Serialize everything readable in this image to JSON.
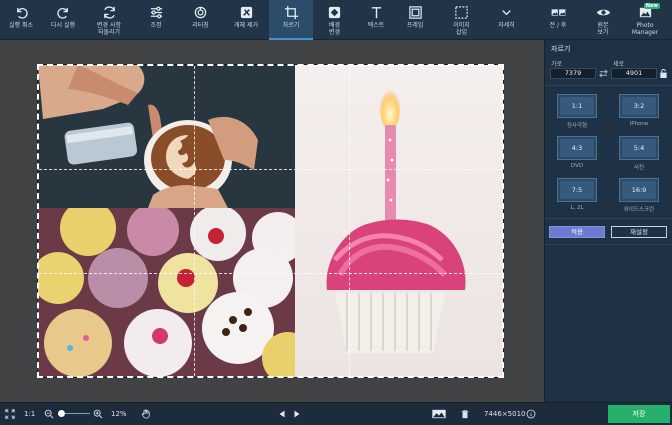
{
  "toolbar": {
    "items": [
      {
        "label": "실행 취소",
        "icon": "undo-icon"
      },
      {
        "label": "다시 실행",
        "icon": "redo-icon"
      },
      {
        "label": "변경 사항\n되돌리기",
        "icon": "revert-icon"
      },
      {
        "label": "조정",
        "icon": "adjust-sliders-icon"
      },
      {
        "label": "리터칭",
        "icon": "retouch-icon"
      },
      {
        "label": "개체 제거",
        "icon": "eraser-icon"
      },
      {
        "label": "자르기",
        "icon": "crop-icon"
      },
      {
        "label": "배경\n변경",
        "icon": "background-icon"
      },
      {
        "label": "텍스트",
        "icon": "text-icon"
      },
      {
        "label": "프레임",
        "icon": "frame-icon"
      },
      {
        "label": "이미지\n삽입",
        "icon": "insert-image-icon"
      },
      {
        "label": "자세히",
        "icon": "chevron-down-icon"
      },
      {
        "label": "전 / 후",
        "icon": "before-after-icon"
      },
      {
        "label": "원본\n보기",
        "icon": "eye-icon"
      },
      {
        "label": "Photo\nManager",
        "icon": "photo-manager-icon",
        "badge": "New"
      }
    ],
    "active_index": 6
  },
  "crop_panel": {
    "title": "자르기",
    "width_label": "가로",
    "height_label": "세로",
    "width_value": "7379",
    "height_value": "4901",
    "ratios": [
      {
        "ratio": "1:1",
        "name": "정사각형"
      },
      {
        "ratio": "3:2",
        "name": "iPhone"
      },
      {
        "ratio": "4:3",
        "name": "DVD"
      },
      {
        "ratio": "5:4",
        "name": "사진"
      },
      {
        "ratio": "7:5",
        "name": "L, 2L"
      },
      {
        "ratio": "16:9",
        "name": "와이드스크린"
      }
    ],
    "apply_label": "적용",
    "reset_label": "재설정"
  },
  "status_bar": {
    "fit_label": "1:1",
    "zoom_value": "12%",
    "zoom_fraction": 0.12,
    "image_size": "7446×5010"
  },
  "save_label": "저장",
  "colors": {
    "accent": "#3d93d6",
    "apply_button": "#6c7bd1",
    "save_button": "#27b06b",
    "toolbar_bg": "#223448",
    "panel_bg": "#1e3145"
  }
}
